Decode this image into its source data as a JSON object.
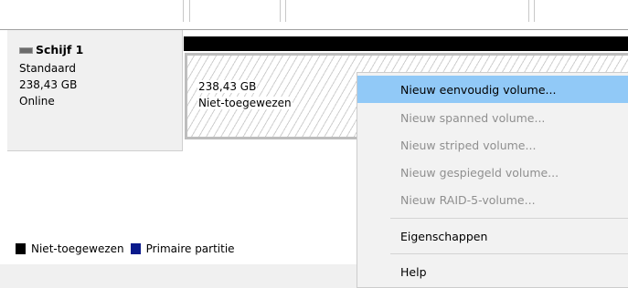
{
  "disk": {
    "title": "Schijf 1",
    "type": "Standaard",
    "size": "238,43 GB",
    "status": "Online"
  },
  "volume": {
    "size": "238,43 GB",
    "status": "Niet-toegewezen"
  },
  "legend": [
    {
      "label": "Niet-toegewezen",
      "color": "#000000"
    },
    {
      "label": "Primaire partitie",
      "color": "#0a1a8c"
    }
  ],
  "context_menu": {
    "items": [
      {
        "label": "Nieuw eenvoudig volume...",
        "enabled": true,
        "highlighted": true
      },
      {
        "label": "Nieuw spanned volume...",
        "enabled": false
      },
      {
        "label": "Nieuw striped volume...",
        "enabled": false
      },
      {
        "label": "Nieuw gespiegeld volume...",
        "enabled": false
      },
      {
        "label": "Nieuw RAID-5-volume...",
        "enabled": false
      },
      {
        "label": "Eigenschappen",
        "enabled": true
      },
      {
        "label": "Help",
        "enabled": true
      }
    ],
    "highlight_color": "#91c9f7"
  }
}
